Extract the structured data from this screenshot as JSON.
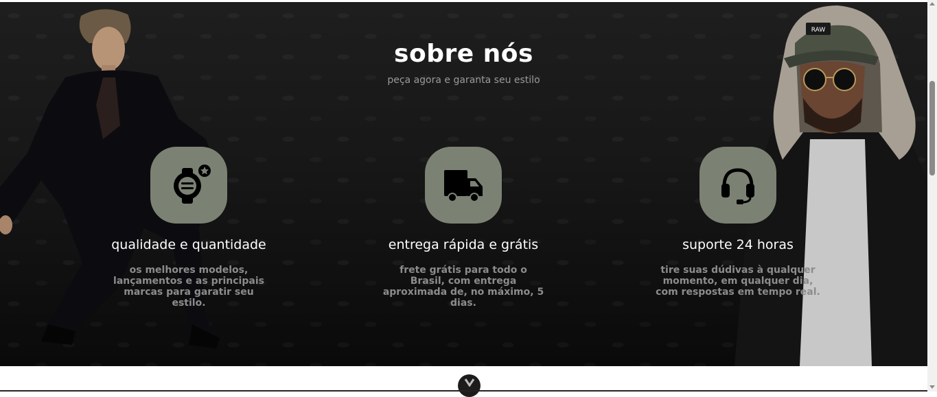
{
  "section": {
    "title": "sobre nós",
    "subtitle": "peça agora e garanta seu estilo"
  },
  "features": [
    {
      "icon": "smartwatch-icon",
      "title": "qualidade e quantidade",
      "description": "os melhores modelos, lançamentos e as principais marcas para garatir seu estilo."
    },
    {
      "icon": "truck-icon",
      "title": "entrega rápida e grátis",
      "description": "frete grátis para todo o Brasil, com entrega aproximada de, no máximo, 5 dias."
    },
    {
      "icon": "headset-icon",
      "title": "suporte 24 horas",
      "description": "tire suas dúdivas à qualquer momento, em qualquer dia, com respostas em tempo real."
    }
  ],
  "cap_text": "RAW",
  "scroll_button": {
    "label": "V",
    "icon": "chevron-down-icon"
  },
  "colors": {
    "background": "#171717",
    "icon_box": "#7b8274",
    "heading": "#ffffff",
    "muted": "#8c8c8c"
  }
}
